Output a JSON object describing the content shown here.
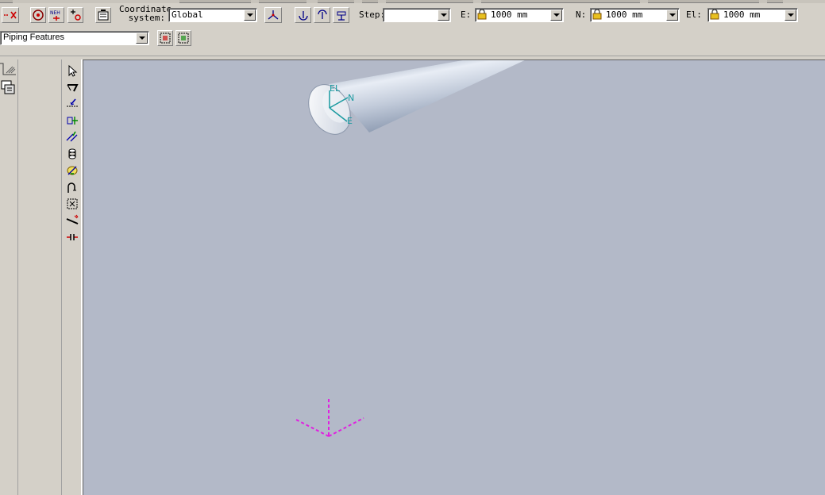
{
  "toolbar1": {
    "coordinate_label_line1": "Coordinate",
    "coordinate_label_line2": "system:",
    "coordinate_value": "Global",
    "step_label": "Step:",
    "step_value": "",
    "e_label": "E:",
    "e_value": "1000 mm",
    "n_label": "N:",
    "n_value": "1000 mm",
    "el_label": "El:",
    "el_value": "1000 mm"
  },
  "toolbar2": {
    "feature_filter_value": "Piping Features"
  },
  "viewport": {
    "background": "#b3b9c8",
    "axis_labels": {
      "el": "EL",
      "n": "N",
      "e": "E"
    },
    "axis_color": "#1a9aa0",
    "target_color": "#e020e0"
  }
}
